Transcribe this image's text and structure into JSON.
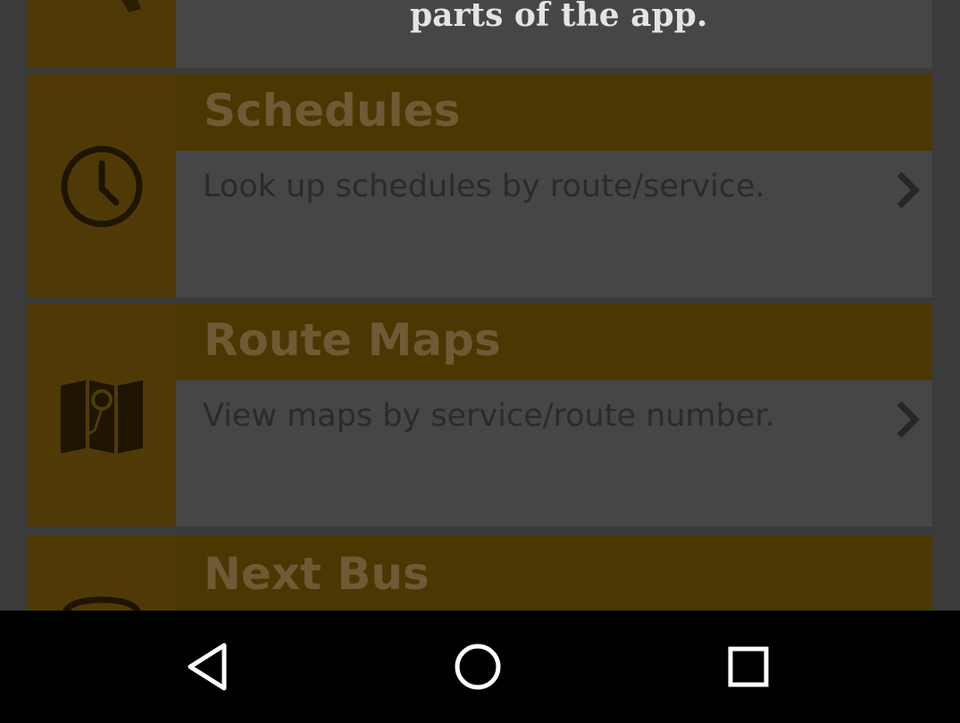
{
  "intro": {
    "text": "parts of the app."
  },
  "cards": [
    {
      "title": "Schedules",
      "description": "Look up schedules by route/service.",
      "icon": "clock-icon"
    },
    {
      "title": "Route Maps",
      "description": "View maps by service/route number.",
      "icon": "map-icon"
    },
    {
      "title": "Next Bus",
      "description": "",
      "icon": "bus-icon"
    }
  ],
  "navigation_bar": {
    "back": "back-icon",
    "home": "home-icon",
    "recents": "recents-icon"
  },
  "colors": {
    "accent_dimmed": "#4a3702",
    "overlay_gray": "#3b3b3b",
    "navbar": "#000000"
  }
}
